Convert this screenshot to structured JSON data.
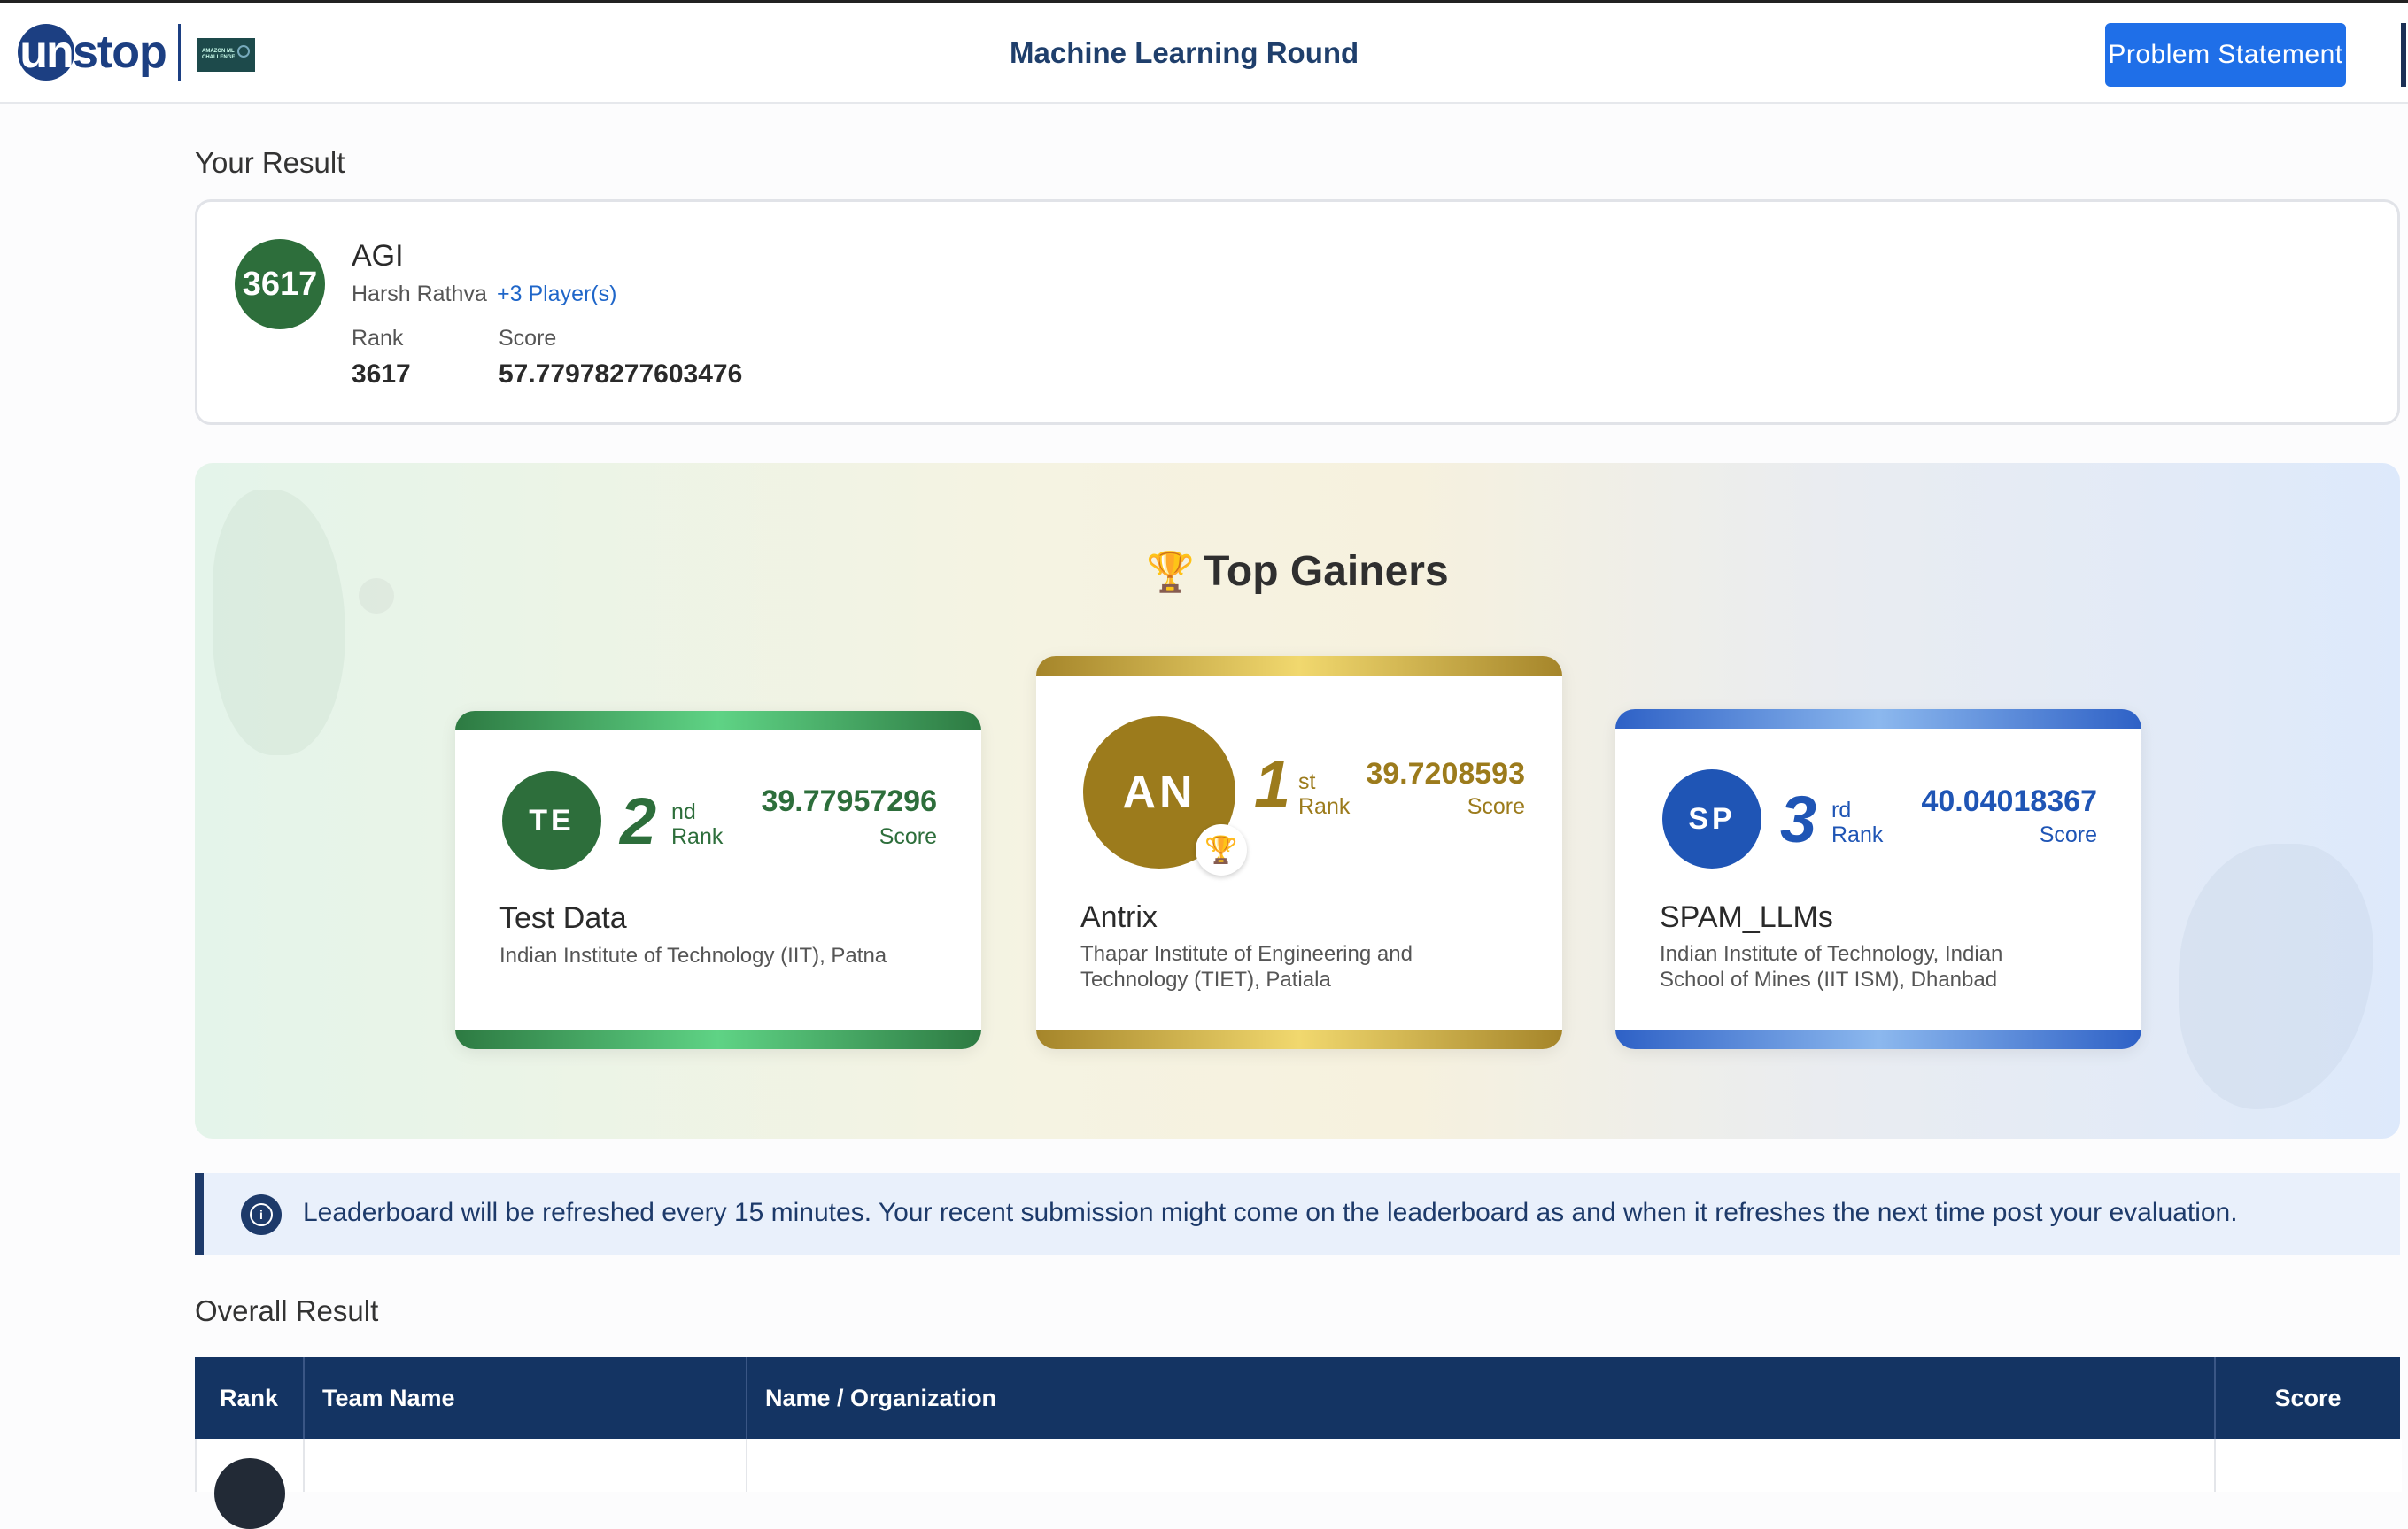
{
  "header": {
    "logo_un": "un",
    "logo_stop": "stop",
    "partner_label": "AMAZON ML CHALLENGE",
    "round_title": "Machine Learning Round",
    "problem_button": "Problem Statement"
  },
  "your_result": {
    "heading": "Your Result",
    "rank_badge": "3617",
    "team_name": "AGI",
    "member": "Harsh Rathva",
    "more_players": "+3 Player(s)",
    "rank_label": "Rank",
    "rank_value": "3617",
    "score_label": "Score",
    "score_value": "57.77978277603476"
  },
  "top_gainers": {
    "title": "Top Gainers",
    "trophy_icon": "🏆",
    "cards": [
      {
        "initials": "TE",
        "rank": "2",
        "suffix": "nd",
        "rank_label": "Rank",
        "score": "39.77957296",
        "score_label": "Score",
        "team": "Test Data",
        "org": "Indian Institute of Technology (IIT), Patna",
        "color": "#2d6e3b"
      },
      {
        "initials": "AN",
        "rank": "1",
        "suffix": "st",
        "rank_label": "Rank",
        "score": "39.7208593",
        "score_label": "Score",
        "team": "Antrix",
        "org_line1": "Thapar Institute of Engineering and",
        "org_line2": "Technology (TIET), Patiala",
        "color": "#9c7b1c"
      },
      {
        "initials": "SP",
        "rank": "3",
        "suffix": "rd",
        "rank_label": "Rank",
        "score": "40.04018367",
        "score_label": "Score",
        "team": "SPAM_LLMs",
        "org_line1": "Indian Institute of Technology, Indian",
        "org_line2": "School of Mines (IIT ISM), Dhanbad",
        "color": "#1f55b5"
      }
    ]
  },
  "info": {
    "icon": "info-icon",
    "text": "Leaderboard will be refreshed every 15 minutes. Your recent submission might come on the leaderboard as and when it refreshes the next time post your evaluation."
  },
  "overall": {
    "heading": "Overall Result",
    "columns": [
      "Rank",
      "Team Name",
      "Name / Organization",
      "Score"
    ]
  }
}
